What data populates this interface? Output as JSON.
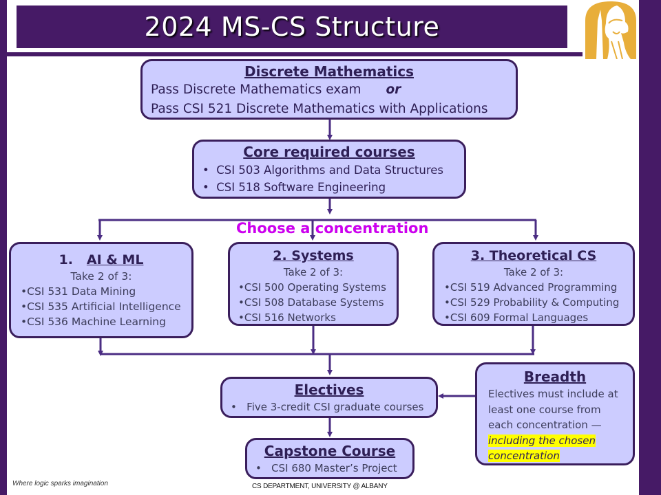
{
  "slide": {
    "title": "2024 MS-CS Structure",
    "tagline": "Where logic sparks imagination",
    "department": "CS DEPARTMENT, UNIVERSITY @ ALBANY",
    "colors": {
      "frame": "#461a66",
      "box_fill": "#ccccff",
      "box_border": "#3a1e5c",
      "arrow": "#4b2d83",
      "choose": "#cc00ee",
      "highlight": "#ffff00",
      "logo": "#e8ae3a"
    }
  },
  "discrete": {
    "heading": "Discrete Mathematics",
    "line1": "Pass Discrete Mathematics exam",
    "or": "or",
    "line2": "Pass CSI 521 Discrete Mathematics with Applications"
  },
  "core": {
    "heading": "Core required courses",
    "items": [
      "CSI 503 Algorithms and Data Structures",
      "CSI 518 Software Engineering"
    ]
  },
  "choose_label": "Choose a concentration",
  "concentrations": [
    {
      "number": "1.",
      "heading": "AI & ML",
      "subtitle": "Take 2 of 3:",
      "items": [
        "CSI 531 Data Mining",
        "CSI 535 Artificial Intelligence",
        "CSI 536 Machine Learning"
      ]
    },
    {
      "heading": "2. Systems",
      "subtitle": "Take 2 of 3:",
      "items": [
        "CSI 500 Operating Systems",
        "CSI 508 Database Systems",
        "CSI 516 Networks"
      ]
    },
    {
      "heading": "3. Theoretical CS",
      "subtitle": "Take 2 of 3:",
      "items": [
        "CSI 519 Advanced Programming",
        "CSI 529 Probability & Computing",
        "CSI 609 Formal Languages"
      ]
    }
  ],
  "electives": {
    "heading": "Electives",
    "items": [
      "Five 3-credit CSI graduate courses"
    ]
  },
  "breadth": {
    "heading": "Breadth",
    "line1": "Electives must include at",
    "line2": "least one course from",
    "line3": "each concentration —",
    "highlight1": "including the chosen",
    "highlight2": "concentration"
  },
  "capstone": {
    "heading": "Capstone Course",
    "items": [
      "CSI 680 Master’s Project"
    ]
  }
}
